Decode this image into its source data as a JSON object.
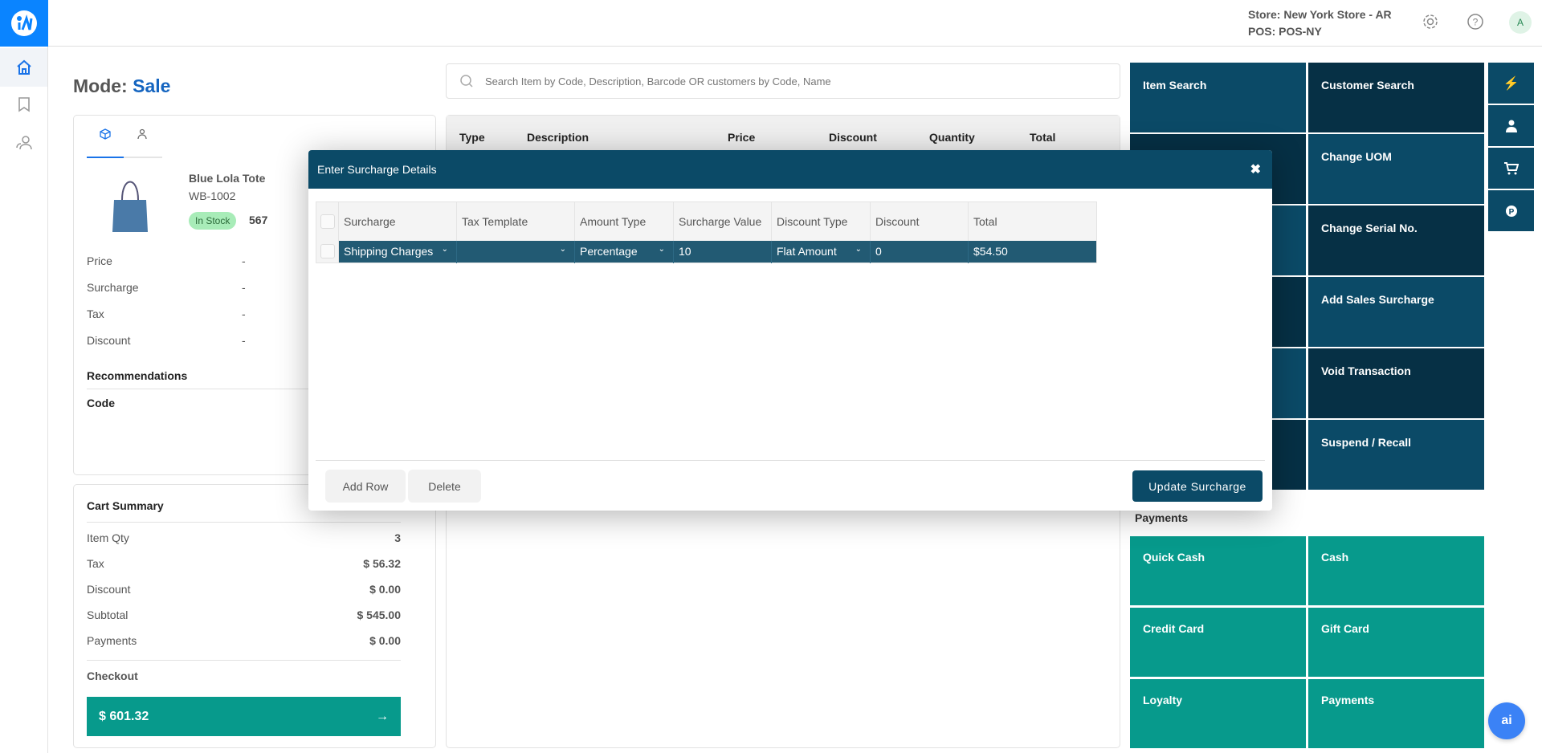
{
  "header": {
    "store": "Store: New York Store - AR",
    "pos": "POS: POS-NY",
    "avatar": "A"
  },
  "mode": {
    "label": "Mode:",
    "value": "Sale"
  },
  "product": {
    "name": "Blue Lola Tote",
    "code": "WB-1002",
    "stock_badge": "In Stock",
    "stock_qty": "567",
    "fields": [
      {
        "label": "Price",
        "value": "-"
      },
      {
        "label": "Surcharge",
        "value": "-"
      },
      {
        "label": "Tax",
        "value": "-"
      },
      {
        "label": "Discount",
        "value": "-"
      }
    ],
    "recommendations": "Recommendations",
    "code_header": "Code"
  },
  "cart": {
    "title": "Cart Summary",
    "rows": [
      {
        "label": "Item Qty",
        "value": "3"
      },
      {
        "label": "Tax",
        "value": "$ 56.32"
      },
      {
        "label": "Discount",
        "value": "$ 0.00"
      },
      {
        "label": "Subtotal",
        "value": "$ 545.00"
      },
      {
        "label": "Payments",
        "value": "$ 0.00"
      }
    ],
    "checkout_label": "Checkout",
    "checkout_total": "$ 601.32"
  },
  "search": {
    "placeholder": "Search Item by Code, Description, Barcode OR customers by Code, Name"
  },
  "cart_table": {
    "columns": [
      "Type",
      "Description",
      "Price",
      "Discount",
      "Quantity",
      "Total"
    ]
  },
  "actions": [
    {
      "label": "Item Search"
    },
    {
      "label": "Customer Search"
    },
    {
      "label": ""
    },
    {
      "label": "Change UOM"
    },
    {
      "label": ""
    },
    {
      "label": "Change Serial No."
    },
    {
      "label": ""
    },
    {
      "label": "Add Sales Surcharge"
    },
    {
      "label": ""
    },
    {
      "label": "Void Transaction"
    },
    {
      "label": ""
    },
    {
      "label": "Suspend / Recall"
    }
  ],
  "quick_icons": [
    "bolt-icon",
    "user-icon",
    "cart-plus-icon",
    "parking-icon"
  ],
  "payments": {
    "title": "Payments",
    "items": [
      "Quick Cash",
      "Cash",
      "Credit Card",
      "Gift Card",
      "Loyalty",
      "Payments"
    ]
  },
  "modal": {
    "title": "Enter Surcharge Details",
    "columns": [
      "Surcharge",
      "Tax Template",
      "Amount Type",
      "Surcharge Value",
      "Discount Type",
      "Discount",
      "Total"
    ],
    "rows": [
      {
        "surcharge": "Shipping Charges",
        "tax_template": "",
        "amount_type": "Percentage",
        "surcharge_value": "10",
        "discount_type": "Flat Amount",
        "discount": "0",
        "total": "$54.50"
      }
    ],
    "add_row": "Add Row",
    "delete": "Delete",
    "update": "Update Surcharge"
  },
  "ai_button": "ai",
  "colors": {
    "primary": "#0b4a67",
    "dark": "#063045",
    "teal": "#079a8c",
    "accent": "#0a84ff"
  }
}
